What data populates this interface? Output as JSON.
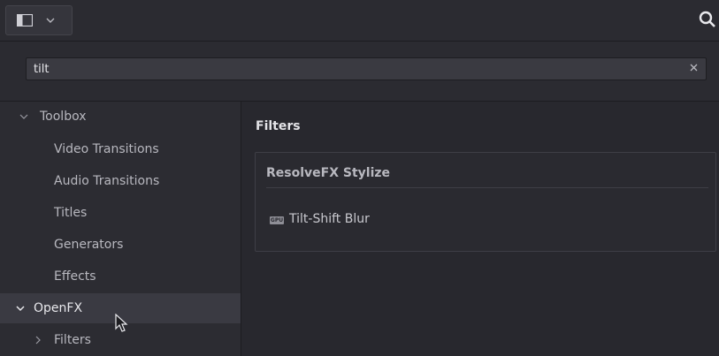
{
  "header": {
    "panel_toggle_icon": "panel-layout-icon",
    "dropdown_icon": "chevron-down-icon",
    "search_icon": "search-icon"
  },
  "search": {
    "value": "tilt",
    "clear_icon": "close-icon"
  },
  "sidebar": {
    "items": [
      {
        "label": "Toolbox",
        "expanded": true,
        "level": 0
      },
      {
        "label": "Video Transitions",
        "level": 1
      },
      {
        "label": "Audio Transitions",
        "level": 1
      },
      {
        "label": "Titles",
        "level": 1
      },
      {
        "label": "Generators",
        "level": 1
      },
      {
        "label": "Effects",
        "level": 1
      },
      {
        "label": "OpenFX",
        "expanded": true,
        "level": 0,
        "selected": true
      },
      {
        "label": "Filters",
        "expanded": false,
        "level": 1
      }
    ]
  },
  "content": {
    "heading": "Filters",
    "group": {
      "title": "ResolveFX Stylize",
      "items": [
        {
          "badge": "GPU",
          "label": "Tilt-Shift Blur"
        }
      ]
    }
  },
  "colors": {
    "background": "#28282e",
    "panel": "#2c2c32",
    "selected_row": "#3a3a42",
    "text": "#c9c9cf"
  }
}
